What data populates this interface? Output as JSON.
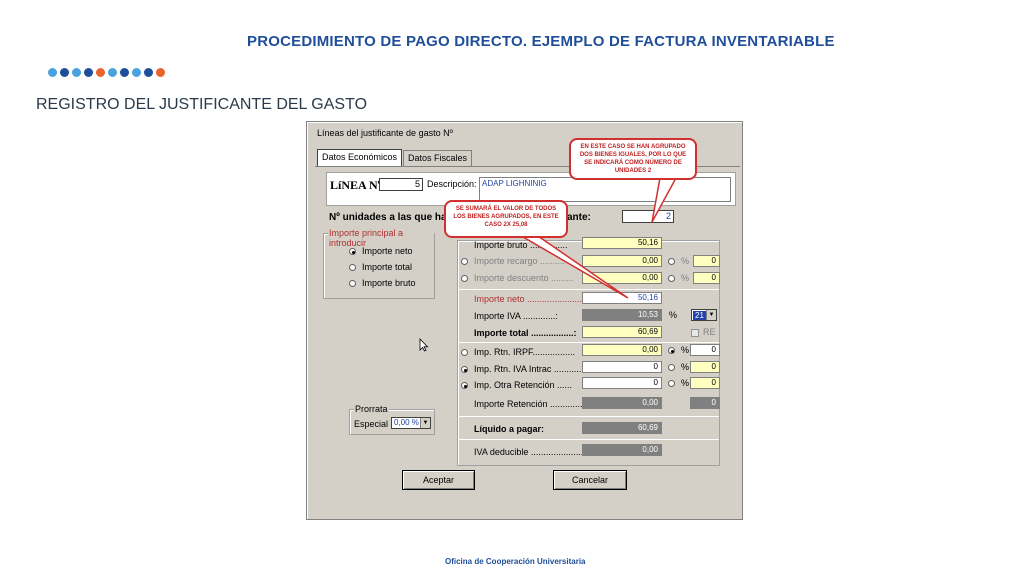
{
  "slide": {
    "title": "PROCEDIMIENTO DE PAGO DIRECTO. EJEMPLO DE FACTURA INVENTARIABLE",
    "section": "REGISTRO DEL JUSTIFICANTE DEL GASTO",
    "footer": "Oficina de Cooperación Universitaria",
    "dot_colors": [
      "#4aa3df",
      "#1f4e9a",
      "#4aa3df",
      "#1f4e9a",
      "#e8642c",
      "#4aa3df",
      "#1f4e9a",
      "#4aa3df",
      "#1f4e9a",
      "#e8642c"
    ]
  },
  "window": {
    "title": "Líneas del justificante de gasto Nº",
    "tabs": [
      {
        "label": "Datos Económicos"
      },
      {
        "label": "Datos Fiscales"
      }
    ],
    "linea_label": "LíNEA Nº",
    "linea_value": "5",
    "desc_label": "Descripción:",
    "desc_value": "ADAP LIGHNINIG",
    "nunid_label": "Nº unidades a las que hac",
    "nunid_tail": "ante:",
    "nunid_value": "2",
    "importe_principal": {
      "legend": "Importe principal a introducir",
      "options": [
        {
          "label": "Importe neto",
          "selected": true
        },
        {
          "label": "Importe total",
          "selected": false
        },
        {
          "label": "Importe bruto",
          "selected": false
        }
      ]
    },
    "rows": {
      "bruto": {
        "label": "Importe bruto ...............",
        "value": "50,16"
      },
      "recargo": {
        "label": "Importe recargo ..........",
        "value": "0,00",
        "pct": "0"
      },
      "descuento": {
        "label": "Importe descuento .........",
        "value": "0,00",
        "pct": "0"
      },
      "neto": {
        "label": "Importe neto ......................",
        "value": "50,16"
      },
      "iva": {
        "label": "Importe IVA .............:",
        "value": "10,53",
        "pct_symbol": "%",
        "rate": "21"
      },
      "total": {
        "label": "Importe total .................:",
        "value": "60,69",
        "re_label": "RE"
      },
      "irpf": {
        "label": "Imp. Rtn. IRPF.................",
        "value": "0,00",
        "pct": "0"
      },
      "iva_intrac": {
        "label": "Imp. Rtn. IVA Intrac ............",
        "value": "0",
        "pct": "0"
      },
      "otra": {
        "label": "Imp. Otra Retención ......",
        "value": "0",
        "pct": "0"
      },
      "retencion": {
        "label": "Importe Retención ..............",
        "value": "0,00",
        "pct": "0"
      },
      "liquido": {
        "label": "Líquido a pagar:",
        "value": "60,69"
      },
      "iva_deducible": {
        "label": "IVA deducible .........................",
        "value": "0,00"
      }
    },
    "percent_symbol": "%",
    "prorrata": {
      "legend": "Prorrata",
      "label": "Especial",
      "value": "0,00 %"
    },
    "buttons": {
      "accept": "Aceptar",
      "cancel": "Cancelar"
    }
  },
  "callouts": {
    "units": "EN ESTE CASO SE HAN AGRUPADO DOS BIENES IGUALES, POR LO QUE SE INDICARÁ COMO NÚMERO DE UNIDADES 2",
    "sum": "SE SUMARÁ EL VALOR DE TODOS LOS BIENES AGRUPADOS, EN ESTE CASO 2X 25,08"
  },
  "icons": {
    "cursor": "arrow-cursor-icon",
    "dropdown": "chevron-down-icon"
  }
}
